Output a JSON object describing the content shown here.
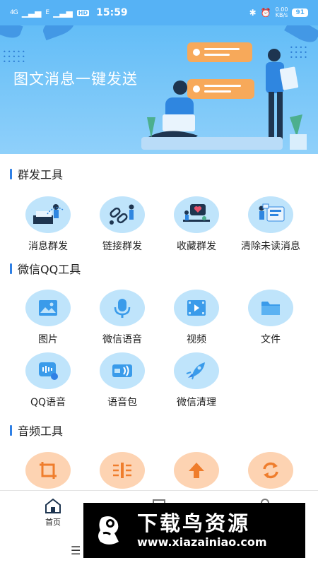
{
  "status_bar": {
    "network_1": "4G",
    "network_2": "E",
    "hd": "HD",
    "time": "15:59",
    "speed_value": "0.00",
    "speed_unit": "KB/s",
    "battery": "91"
  },
  "banner": {
    "title": "图文消息一键发送"
  },
  "sections": {
    "group_tools": "群发工具",
    "wechat_qq_tools": "微信QQ工具",
    "audio_tools": "音频工具"
  },
  "group_tools": [
    {
      "label": "消息群发",
      "icon": "message-broadcast-illustration"
    },
    {
      "label": "链接群发",
      "icon": "link-broadcast-illustration"
    },
    {
      "label": "收藏群发",
      "icon": "favorites-broadcast-illustration"
    },
    {
      "label": "清除未读消息",
      "icon": "clear-unread-illustration"
    }
  ],
  "wechat_qq_tools": [
    {
      "label": "图片",
      "icon": "image-icon"
    },
    {
      "label": "微信语音",
      "icon": "microphone-icon"
    },
    {
      "label": "视频",
      "icon": "video-icon"
    },
    {
      "label": "文件",
      "icon": "folder-icon"
    },
    {
      "label": "QQ语音",
      "icon": "voice-message-icon"
    },
    {
      "label": "语音包",
      "icon": "voice-pack-icon"
    },
    {
      "label": "微信清理",
      "icon": "rocket-icon"
    }
  ],
  "audio_tools": [
    {
      "icon": "crop-icon"
    },
    {
      "icon": "split-icon"
    },
    {
      "icon": "upload-icon"
    },
    {
      "icon": "convert-icon"
    }
  ],
  "bottom_nav": {
    "home": "首页"
  },
  "watermark": {
    "name": "下载鸟资源",
    "url": "www.xiazainiao.com"
  },
  "colors": {
    "accent": "#2f80e5",
    "banner_blue": "#63bdf7",
    "tool_blue": "#bfe4fb",
    "tool_orange": "#fdd3b2"
  }
}
